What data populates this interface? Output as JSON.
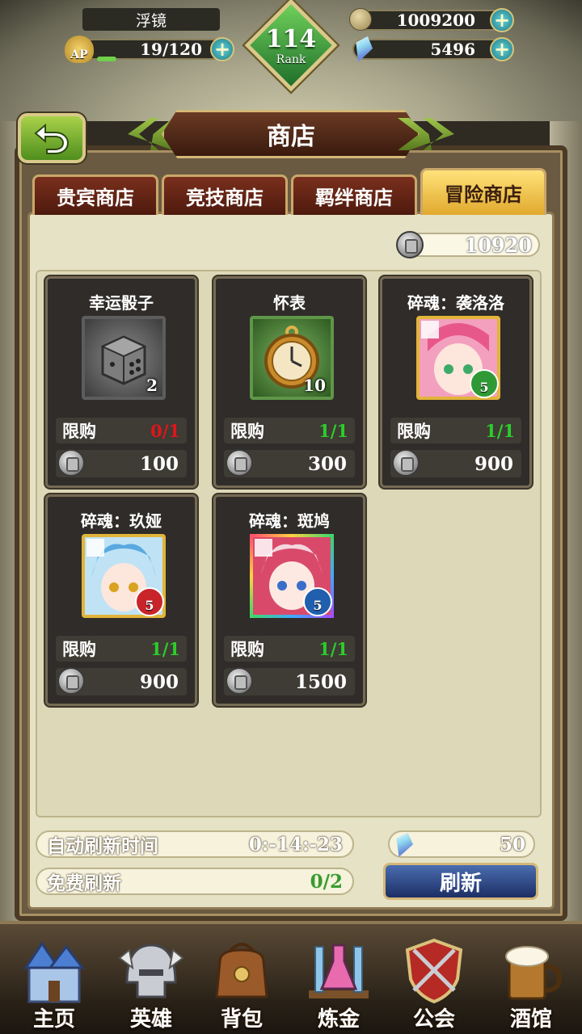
{
  "hud": {
    "player_name": "浮镜",
    "ap_label": "AP",
    "ap_value": "19/120",
    "ap_fraction": 0.158,
    "gold": "1009200",
    "gems": "5496",
    "rank_number": "114",
    "rank_label": "Rank"
  },
  "title": "商店",
  "tabs": [
    {
      "label": "贵宾商店",
      "active": false
    },
    {
      "label": "竞技商店",
      "active": false
    },
    {
      "label": "羁绊商店",
      "active": false
    },
    {
      "label": "冒险商店",
      "active": true
    }
  ],
  "shop": {
    "balance": "10920",
    "items": [
      {
        "name": "幸运骰子",
        "quantity": "2",
        "limit_label": "限购",
        "limit": "0/1",
        "limit_color": "#e0151b",
        "price": "100",
        "frame": "grey",
        "icon": "dice-icon"
      },
      {
        "name": "怀表",
        "quantity": "10",
        "limit_label": "限购",
        "limit": "1/1",
        "limit_color": "#2ccd2a",
        "price": "300",
        "frame": "green",
        "icon": "pocket-watch-icon"
      },
      {
        "name": "碎魂：袭洛洛",
        "quantity": "5",
        "limit_label": "限购",
        "limit": "1/1",
        "limit_color": "#2ccd2a",
        "price": "900",
        "frame": "gold",
        "icon": "soul-fragment-portrait",
        "element": "green"
      },
      {
        "name": "碎魂：玖娅",
        "quantity": "5",
        "limit_label": "限购",
        "limit": "1/1",
        "limit_color": "#2ccd2a",
        "price": "900",
        "frame": "goldb",
        "icon": "soul-fragment-portrait",
        "element": "red"
      },
      {
        "name": "碎魂：斑鸠",
        "quantity": "5",
        "limit_label": "限购",
        "limit": "1/1",
        "limit_color": "#2ccd2a",
        "price": "1500",
        "frame": "rainbow",
        "icon": "soul-fragment-portrait",
        "element": "blue"
      }
    ]
  },
  "refresh": {
    "auto_label": "自动刷新时间",
    "auto_time": "0:-14:-23",
    "free_label": "免费刷新",
    "free_value": "0/2",
    "gem_cost": "50",
    "button_label": "刷新"
  },
  "nav": [
    {
      "label": "主页",
      "icon": "castle-icon"
    },
    {
      "label": "英雄",
      "icon": "helmet-icon"
    },
    {
      "label": "背包",
      "icon": "bag-icon"
    },
    {
      "label": "炼金",
      "icon": "flask-icon"
    },
    {
      "label": "公会",
      "icon": "shield-icon"
    },
    {
      "label": "酒馆",
      "icon": "beer-mug-icon"
    }
  ],
  "colors": {
    "accent_green": "#2ccd2a",
    "limit_red": "#e0151b",
    "tab_active": "#f0c048",
    "tab_inactive": "#6a2718",
    "refresh_button": "#2c4585"
  }
}
